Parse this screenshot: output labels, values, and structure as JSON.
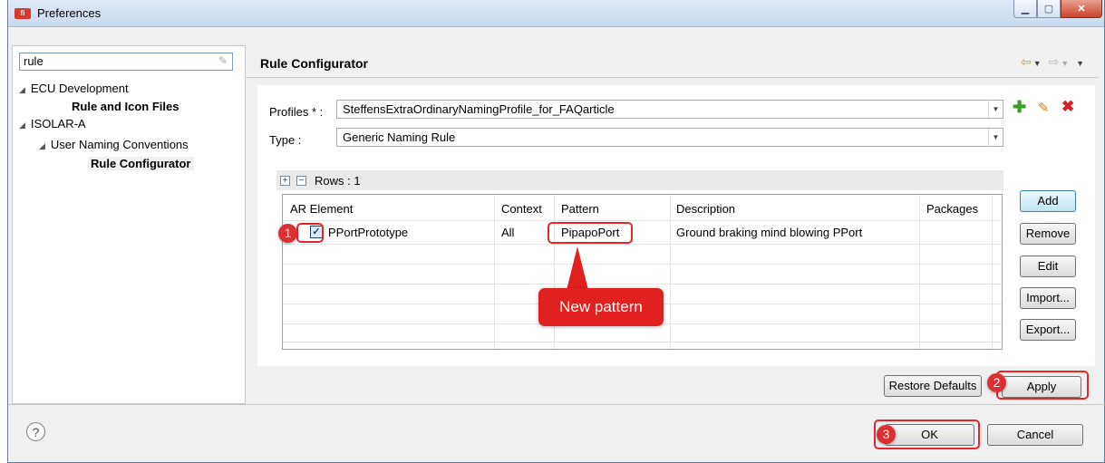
{
  "window": {
    "title": "Preferences",
    "app_icon_text": "fi"
  },
  "filter": {
    "value": "rule"
  },
  "tree": {
    "ecu_development": "ECU Development",
    "rule_and_icon_files": "Rule and Icon Files",
    "isolar_a": "ISOLAR-A",
    "user_naming_conventions": "User Naming Conventions",
    "rule_configurator": "Rule Configurator"
  },
  "page": {
    "title": "Rule Configurator"
  },
  "profiles": {
    "label": "Profiles * :",
    "value": "SteffensExtraOrdinaryNamingProfile_for_FAQarticle"
  },
  "type": {
    "label": "Type :",
    "value": "Generic Naming Rule"
  },
  "rows": {
    "label": "Rows : 1"
  },
  "table": {
    "headers": [
      "AR Element",
      "Context",
      "Pattern",
      "Description",
      "Packages"
    ],
    "rows": [
      {
        "ar_element": "PPortPrototype",
        "context": "All",
        "pattern": "PipapoPort",
        "description": "Ground braking mind blowing PPort",
        "packages": ""
      }
    ]
  },
  "side_buttons": {
    "add": "Add",
    "remove": "Remove",
    "edit": "Edit",
    "import": "Import...",
    "export": "Export..."
  },
  "footer": {
    "restore_defaults": "Restore Defaults",
    "apply": "Apply",
    "ok": "OK",
    "cancel": "Cancel",
    "help": "?"
  },
  "callouts": {
    "step1": "1",
    "step2": "2",
    "step3": "3",
    "bubble": "New pattern"
  },
  "colors": {
    "callout_red": "#e1211f",
    "titlebar": "#c9daee",
    "add_green": "#3a9d2a"
  }
}
